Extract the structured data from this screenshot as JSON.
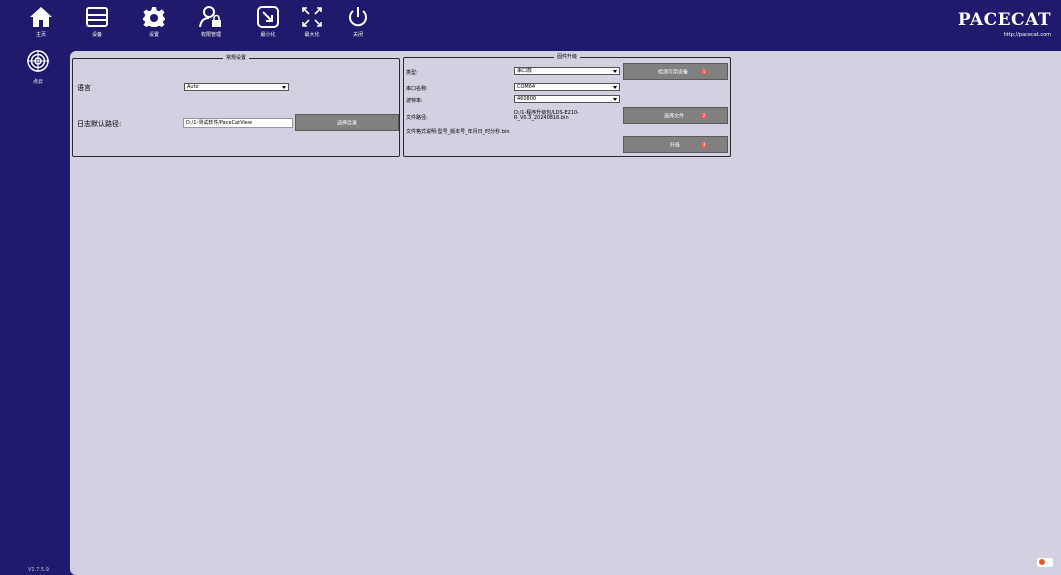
{
  "toolbar": {
    "home": "主页",
    "device": "设备",
    "settings": "设置",
    "users": "权限管理",
    "minimize": "最小化",
    "maximize": "最大化",
    "close": "关闭"
  },
  "sidebar": {
    "pointcloud": "点云"
  },
  "brand": {
    "logo_text": "PACECAT",
    "url": "http://pacecat.com"
  },
  "version": "V1.7.5.9",
  "general": {
    "title": "常规设置",
    "language_label": "语言",
    "language_value": "Auto",
    "log_path_label": "日志默认路径:",
    "log_path_value": "D:/1-测试软件/PaceCatView",
    "choose_path_button": "选择目录"
  },
  "firmware": {
    "title": "固件升级",
    "type_label": "类型:",
    "type_value": "串口款",
    "port_label": "串口名称:",
    "port_value": "COM64",
    "baud_label": "波特率:",
    "baud_value": "460800",
    "path_label": "文件路径:",
    "path_value_line1": "D:/1-程序升级包/LDS-E210-",
    "path_value_line2": "R_V0.3_20240816.bin",
    "format_note": "文件格式说明:型号_版本号_年月日_时分秒.bin",
    "detect_button": "检测可用设备",
    "choose_file_button": "选择文件",
    "upgrade_button": "升级",
    "badge_1": "1",
    "badge_2": "2",
    "badge_3": "3"
  },
  "colors": {
    "background": "#1f1a6b",
    "panel": "#d2d0e1",
    "button": "#808080",
    "badge": "#e85a5a"
  }
}
